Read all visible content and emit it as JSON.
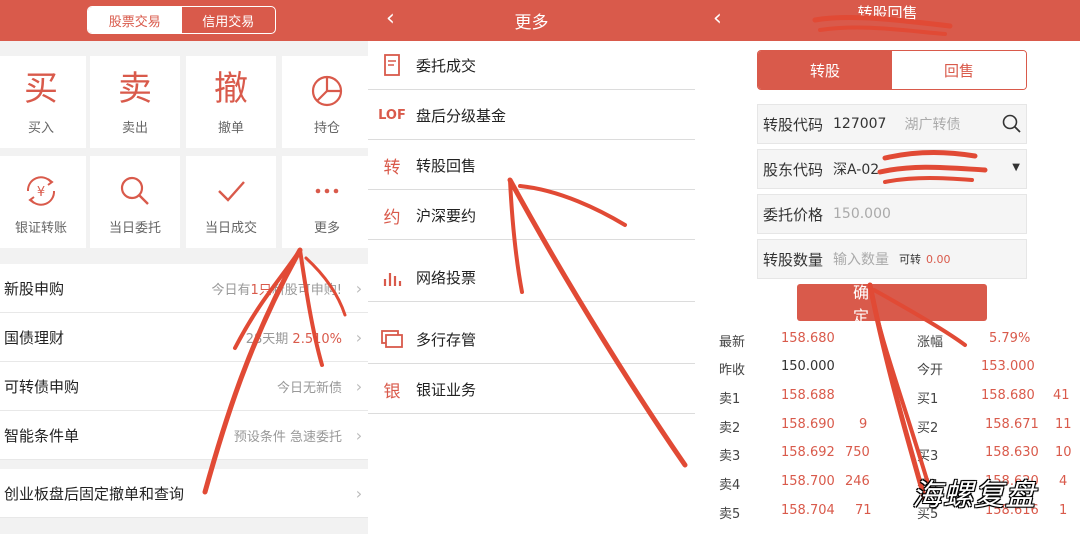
{
  "panel1": {
    "tabs": [
      "股票交易",
      "信用交易"
    ],
    "tiles": [
      {
        "glyph": "买",
        "label": "买入"
      },
      {
        "glyph": "卖",
        "label": "卖出"
      },
      {
        "glyph": "撤",
        "label": "撤单"
      },
      {
        "icon": "pie-chart-icon",
        "label": "持仓"
      },
      {
        "icon": "yen-transfer-icon",
        "label": "银证转账"
      },
      {
        "icon": "search-icon",
        "label": "当日委托"
      },
      {
        "icon": "check-icon",
        "label": "当日成交"
      },
      {
        "icon": "more-dots-icon",
        "label": "更多"
      }
    ],
    "rows": [
      {
        "title": "新股申购",
        "hint_pre": "今日有",
        "hint_em": "1只",
        "hint_post": "新股可申购!"
      },
      {
        "title": "国债理财",
        "hint_pre": "28天期",
        "hint_em": "",
        "hint_post": "2.510%"
      },
      {
        "title": "可转债申购",
        "hint_pre": "今日无新债",
        "hint_em": "",
        "hint_post": ""
      },
      {
        "title": "智能条件单",
        "hint_pre": "预设条件 急速委托",
        "hint_em": "",
        "hint_post": ""
      },
      {
        "title": "创业板盘后固定撤单和查询",
        "hint_pre": "",
        "hint_em": "",
        "hint_post": ""
      }
    ],
    "chevron": "›"
  },
  "panel2": {
    "title": "更多",
    "back": "‹",
    "items": [
      {
        "icon": "document-icon",
        "badge": "",
        "label": "委托成交"
      },
      {
        "icon": "lof-icon",
        "badge": "LOF",
        "label": "盘后分级基金"
      },
      {
        "icon": "zhuan-icon",
        "badge": "转",
        "label": "转股回售"
      },
      {
        "icon": "yue-icon",
        "badge": "约",
        "label": "沪深要约"
      },
      {
        "icon": "bar-chart-icon",
        "badge": "",
        "label": "网络投票"
      },
      {
        "icon": "multi-window-icon",
        "badge": "",
        "label": "多行存管"
      },
      {
        "icon": "yin-icon",
        "badge": "银",
        "label": "银证业务"
      }
    ]
  },
  "panel3": {
    "title": "转股回售",
    "back": "‹",
    "tabs": [
      "转股",
      "回售"
    ],
    "form": {
      "code_label": "转股代码",
      "code_value": "127007",
      "code_name": "湖广转债",
      "holder_label": "股东代码",
      "holder_value": "深A-02",
      "price_label": "委托价格",
      "price_placeholder": "150.000",
      "qty_label": "转股数量",
      "qty_placeholder": "输入数量",
      "avail_label": "可转",
      "avail_value": "0.00"
    },
    "confirm_label": "确定",
    "quote": {
      "latest_label": "最新",
      "latest": "158.680",
      "change_label": "涨幅",
      "change": "5.79%",
      "prevclose_label": "昨收",
      "prevclose": "150.000",
      "open_label": "今开",
      "open": "153.000",
      "asks": [
        {
          "label": "卖1",
          "price": "158.688",
          "vol": ""
        },
        {
          "label": "卖2",
          "price": "158.690",
          "vol": "9"
        },
        {
          "label": "卖3",
          "price": "158.692",
          "vol": "750"
        },
        {
          "label": "卖4",
          "price": "158.700",
          "vol": "246"
        },
        {
          "label": "卖5",
          "price": "158.704",
          "vol": "71"
        }
      ],
      "bids": [
        {
          "label": "买1",
          "price": "158.680",
          "vol": "41"
        },
        {
          "label": "买2",
          "price": "158.671",
          "vol": "11"
        },
        {
          "label": "买3",
          "price": "158.630",
          "vol": "10"
        },
        {
          "label": "买4",
          "price": "158.620",
          "vol": "4"
        },
        {
          "label": "买5",
          "price": "158.616",
          "vol": "1"
        }
      ]
    }
  },
  "watermark": "海螺复盘",
  "colors": {
    "accent": "#d95a4b",
    "annotation": "#e14a35"
  }
}
